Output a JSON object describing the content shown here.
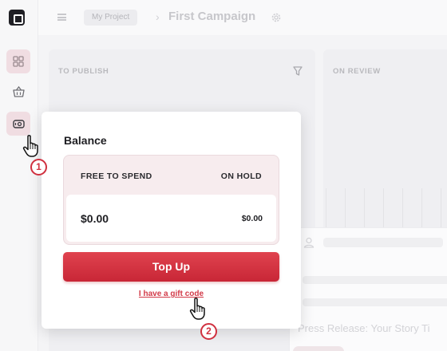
{
  "header": {
    "project": "My Project",
    "separator": "›",
    "campaign_title": "First Campaign"
  },
  "board": {
    "columns": [
      {
        "title": "TO PUBLISH"
      },
      {
        "title": "ON REVIEW"
      }
    ]
  },
  "task_card": {
    "title": "Press Release: Your Story Ti"
  },
  "balance_popover": {
    "title": "Balance",
    "free_label": "FREE TO SPEND",
    "hold_label": "ON HOLD",
    "free_amount": "$0.00",
    "hold_amount": "$0.00",
    "topup_label": "Top Up",
    "gift_link": "I have a gift code"
  },
  "annotations": {
    "step1": "1",
    "step2": "2"
  },
  "colors": {
    "accent": "#d0303f",
    "balance_box": "#f7ecee"
  },
  "icons": {
    "sidebar": [
      "dashboard-icon",
      "basket-icon",
      "wallet-icon"
    ],
    "header": [
      "hamburger-icon",
      "gear-icon"
    ],
    "column": [
      "filter-icon"
    ]
  }
}
